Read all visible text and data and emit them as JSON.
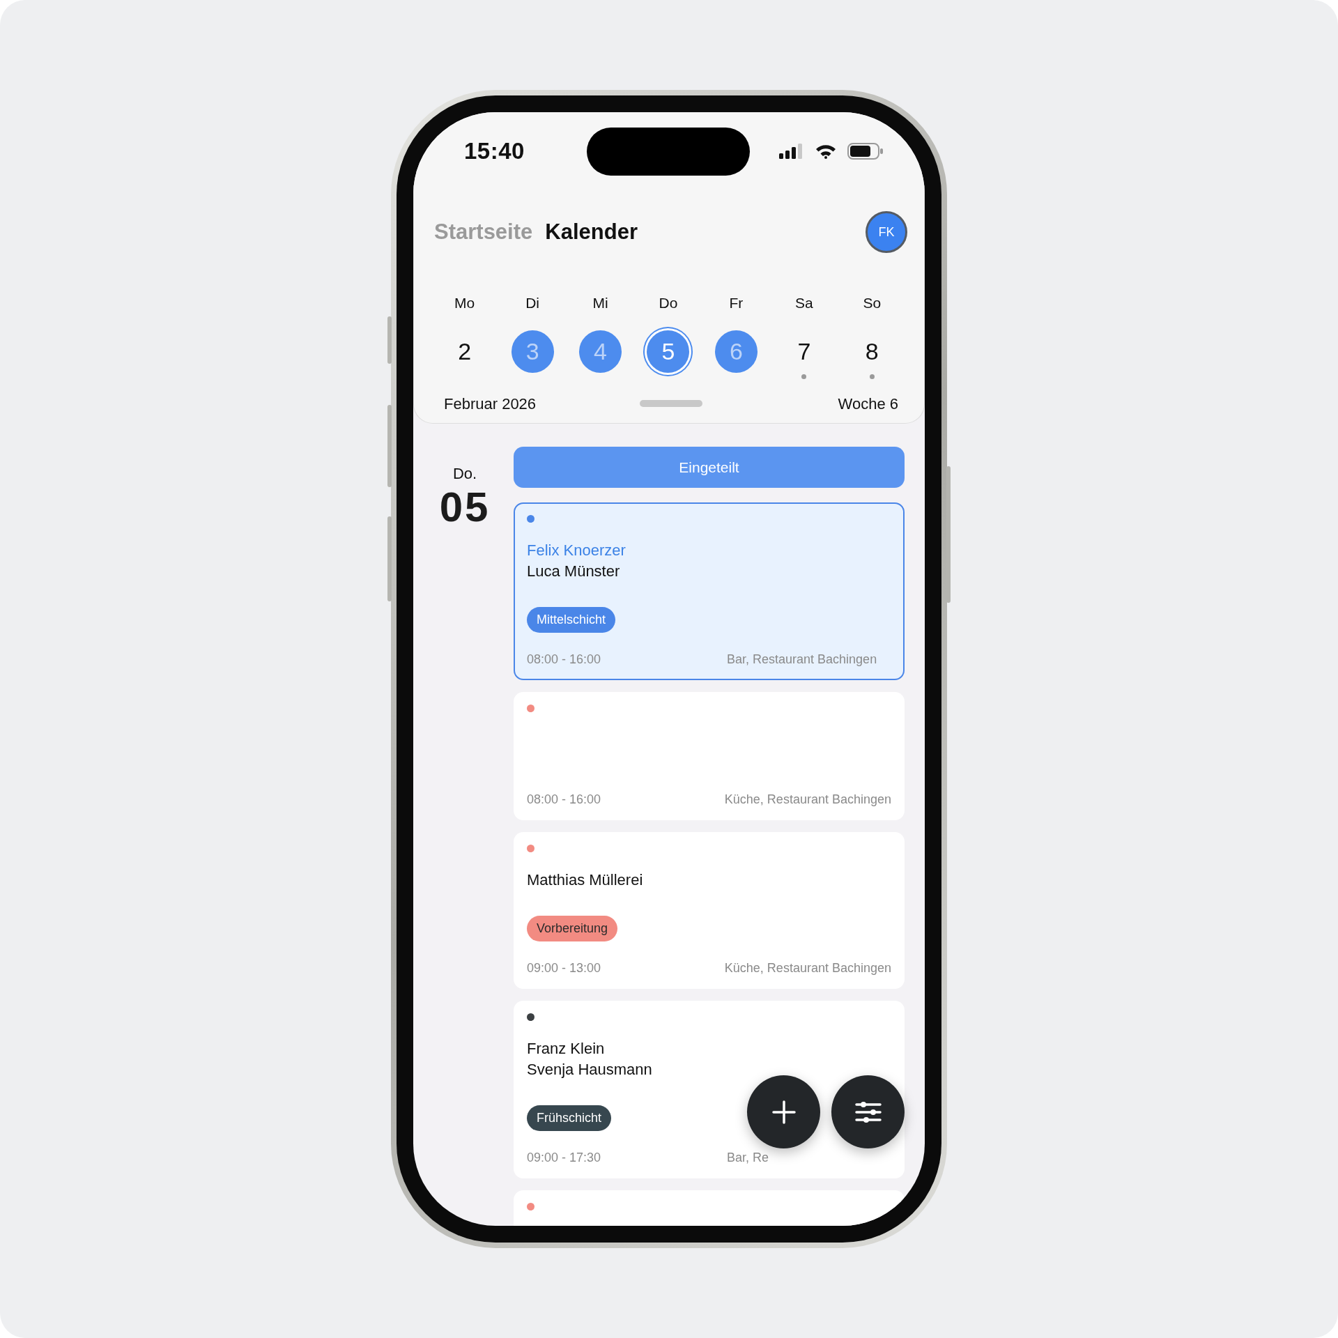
{
  "status_bar": {
    "time": "15:40"
  },
  "nav": {
    "tabs": [
      {
        "label": "Startseite",
        "selected": false
      },
      {
        "label": "Kalender",
        "selected": true
      }
    ],
    "avatar": {
      "initials": "FK"
    }
  },
  "week": {
    "days": [
      {
        "weekday": "Mo",
        "day": "2",
        "scheduled": false,
        "selected": false,
        "marked": false
      },
      {
        "weekday": "Di",
        "day": "3",
        "scheduled": true,
        "selected": false,
        "marked": false
      },
      {
        "weekday": "Mi",
        "day": "4",
        "scheduled": true,
        "selected": false,
        "marked": false
      },
      {
        "weekday": "Do",
        "day": "5",
        "scheduled": true,
        "selected": true,
        "marked": false
      },
      {
        "weekday": "Fr",
        "day": "6",
        "scheduled": true,
        "selected": false,
        "marked": false
      },
      {
        "weekday": "Sa",
        "day": "7",
        "scheduled": false,
        "selected": false,
        "marked": true
      },
      {
        "weekday": "So",
        "day": "8",
        "scheduled": false,
        "selected": false,
        "marked": true
      }
    ],
    "month": "Februar 2026",
    "week_label": "Woche 6"
  },
  "date": {
    "weekday": "Do.",
    "day": "05"
  },
  "filter": {
    "label": "Eingeteilt"
  },
  "shifts": [
    {
      "color": "#4a86e8",
      "selected": true,
      "names": [
        {
          "text": "Felix Knoerzer",
          "self": true
        },
        {
          "text": "Luca Münster",
          "self": false
        }
      ],
      "tag": {
        "label": "Mittelschicht",
        "color": "#4a86e8"
      },
      "time": "08:00 - 16:00",
      "location": "Bar, Restaurant Bachingen"
    },
    {
      "color": "#f28b82",
      "selected": false,
      "time": "08:00 - 16:00",
      "location": "Küche, Restaurant Bachingen"
    },
    {
      "color": "#f28b82",
      "selected": false,
      "names": [
        {
          "text": "Matthias Müllerei",
          "self": false
        }
      ],
      "tag": {
        "label": "Vorbereitung",
        "color": "#f28b82"
      },
      "time": "09:00 - 13:00",
      "location": "Küche, Restaurant Bachingen"
    },
    {
      "color": "#3c4043",
      "selected": false,
      "names": [
        {
          "text": "Franz Klein",
          "self": false
        },
        {
          "text": "Svenja Hausmann",
          "self": false
        }
      ],
      "tag": {
        "label": "Frühschicht",
        "color": "#37474f"
      },
      "time": "09:00 - 17:30",
      "location": "Bar, Re"
    },
    {
      "color": "#f28b82",
      "selected": false
    }
  ]
}
